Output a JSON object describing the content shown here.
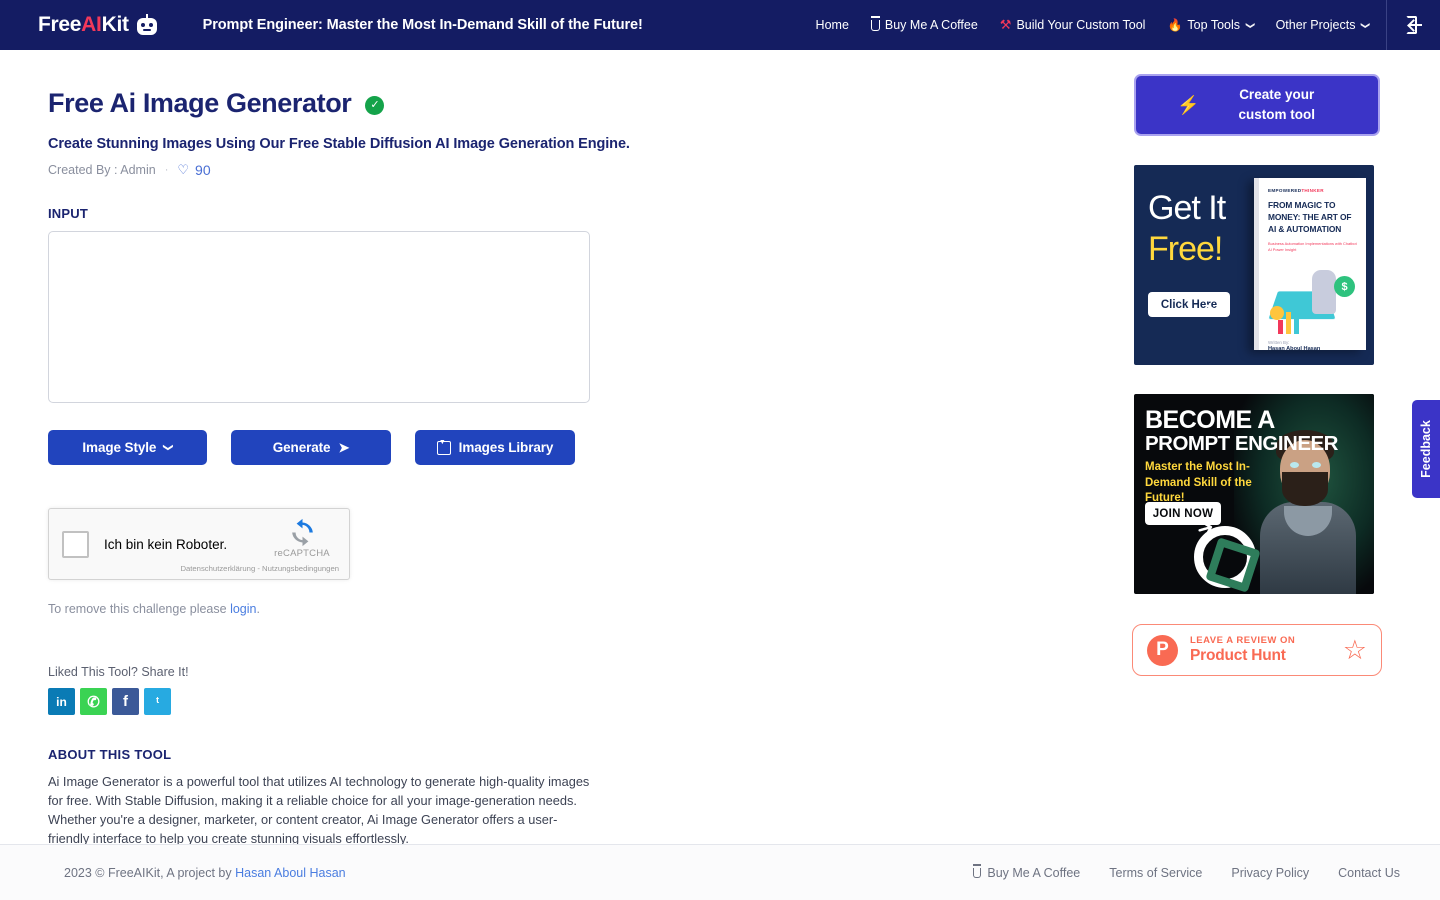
{
  "header": {
    "logo": {
      "part1": "Free",
      "part2": "AI",
      "part3": "Kit",
      "icon": "robot-icon"
    },
    "tagline": "Prompt Engineer: Master the Most In-Demand Skill of the Future!",
    "nav": [
      {
        "label": "Home",
        "icon": null,
        "caret": false
      },
      {
        "label": "Buy Me A Coffee",
        "icon": "coffee-icon",
        "caret": false
      },
      {
        "label": "Build Your Custom Tool",
        "icon": "tools-icon",
        "caret": false
      },
      {
        "label": "Top Tools",
        "icon": "fire-icon",
        "caret": true
      },
      {
        "label": "Other Projects",
        "icon": null,
        "caret": true
      }
    ],
    "logout_icon": "logout-icon"
  },
  "tool": {
    "title": "Free Ai Image Generator",
    "verified_icon": "verified-check-icon",
    "subtitle": "Create Stunning Images Using Our Free Stable Diffusion AI Image Generation Engine.",
    "created_by": "Created By : Admin",
    "separator": "·",
    "heart_icon": "heart-icon",
    "likes": "90"
  },
  "input": {
    "label": "INPUT",
    "value": "",
    "placeholder": ""
  },
  "buttons": {
    "image_style": "Image Style",
    "image_style_caret": "⌄",
    "generate": "Generate",
    "generate_icon": "➤",
    "images_library": "Images Library",
    "images_library_icon": "download-box-icon"
  },
  "recaptcha": {
    "label": "Ich bin kein Roboter.",
    "brand": "reCAPTCHA",
    "terms": "Datenschutzerklärung - Nutzungsbedingungen",
    "note_prefix": "To remove this challenge please ",
    "note_link": "login",
    "note_suffix": "."
  },
  "share": {
    "label": "Liked This Tool? Share It!",
    "items": [
      {
        "name": "linkedin",
        "glyph": "in",
        "color": "#0a7bb5"
      },
      {
        "name": "whatsapp",
        "glyph": "✆",
        "color": "#3ad353"
      },
      {
        "name": "facebook",
        "glyph": "f",
        "color": "#3b5998"
      },
      {
        "name": "twitter",
        "glyph": "ᵗ",
        "color": "#27aae1"
      }
    ]
  },
  "about": {
    "heading": "ABOUT THIS TOOL",
    "body": "Ai Image Generator is a powerful tool that utilizes AI technology to generate high-quality images for free. With Stable Diffusion, making it a reliable choice for all your image-generation needs. Whether you're a designer, marketer, or content creator, Ai Image Generator offers a user-friendly interface to help you create stunning visuals effortlessly."
  },
  "sidebar": {
    "cta": {
      "label": "Create your custom tool",
      "icon": "lightning-bolt-icon"
    },
    "ad_ebook": {
      "line1": "Get It",
      "line2": "Free!",
      "button": "Click Here",
      "book_tag_a": "EMPOWERED",
      "book_tag_b": "THINKER",
      "book_title": "FROM MAGIC TO MONEY: THE ART OF AI & AUTOMATION",
      "book_sub": "Business Automation Implementations with Chatbot AI Power Insight",
      "book_by": "Written By:",
      "book_author": "Hasan Aboul Hasan"
    },
    "ad_course": {
      "line1": "BECOME A",
      "line2": "PROMPT ENGINEER",
      "line3": "Master the Most In-Demand Skill of the Future!",
      "button": "JOIN NOW"
    },
    "product_hunt": {
      "badge_letter": "P",
      "line1": "LEAVE A REVIEW ON",
      "line2": "Product Hunt",
      "star_icon": "star-icon"
    }
  },
  "feedback_tab": {
    "label": "Feedback"
  },
  "footer": {
    "copyright_prefix": "2023 © FreeAIKit, A project by ",
    "author": "Hasan Aboul Hasan",
    "links": [
      {
        "label": "Buy Me A Coffee",
        "icon": "coffee-icon"
      },
      {
        "label": "Terms of Service",
        "icon": null
      },
      {
        "label": "Privacy Policy",
        "icon": null
      },
      {
        "label": "Contact Us",
        "icon": null
      }
    ]
  },
  "colors": {
    "header_bg": "#141c63",
    "primary_button": "#2144bd",
    "accent_red": "#f2385a",
    "cta_purple": "#3b34c7",
    "verified_green": "#14a34a",
    "product_hunt": "#f96a53",
    "link_blue": "#4a7de0"
  }
}
